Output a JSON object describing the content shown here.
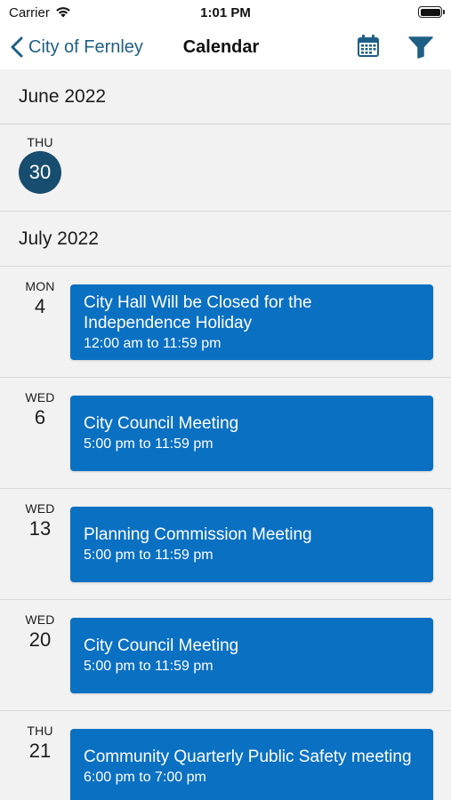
{
  "status_bar": {
    "carrier": "Carrier",
    "time": "1:01 PM"
  },
  "nav": {
    "back_label": "City of Fernley",
    "title": "Calendar",
    "icons": [
      "calendar-icon",
      "filter-icon"
    ]
  },
  "colors": {
    "accent": "#1e5f86",
    "event_card": "#0a70c2",
    "today_circle": "#174d6e",
    "background": "#f2f2f2"
  },
  "months": [
    {
      "label": "June 2022",
      "days": [
        {
          "dow": "THU",
          "day": "30",
          "today": true,
          "events": []
        }
      ]
    },
    {
      "label": "July 2022",
      "days": [
        {
          "dow": "MON",
          "day": "4",
          "events": [
            {
              "title": "City Hall Will be Closed for the Independence Holiday",
              "time": "12:00 am to 11:59 pm"
            }
          ]
        },
        {
          "dow": "WED",
          "day": "6",
          "events": [
            {
              "title": "City Council Meeting",
              "time": "5:00 pm to 11:59 pm"
            }
          ]
        },
        {
          "dow": "WED",
          "day": "13",
          "events": [
            {
              "title": "Planning Commission Meeting",
              "time": "5:00 pm to 11:59 pm"
            }
          ]
        },
        {
          "dow": "WED",
          "day": "20",
          "events": [
            {
              "title": "City Council Meeting",
              "time": "5:00 pm to 11:59 pm"
            }
          ]
        },
        {
          "dow": "THU",
          "day": "21",
          "events": [
            {
              "title": "Community Quarterly Public Safety meeting",
              "time": "6:00 pm to 7:00 pm"
            }
          ]
        }
      ]
    }
  ]
}
